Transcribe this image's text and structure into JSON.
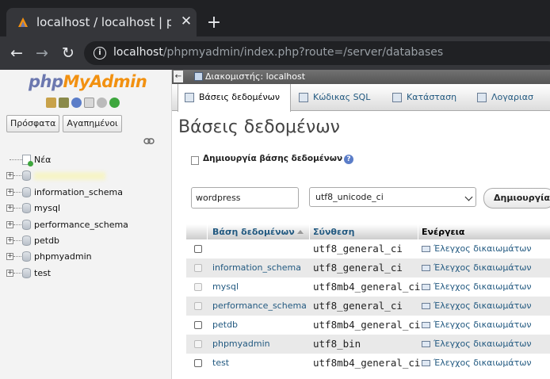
{
  "browser": {
    "tab_title": "localhost / localhost | phpMyAdmin",
    "close_glyph": "✕",
    "newtab_glyph": "+",
    "url_host": "localhost",
    "url_path": "/phpmyadmin/index.php?route=/server/databases",
    "back_glyph": "←",
    "forward_glyph": "→",
    "reload_glyph": "↻",
    "info_glyph": "i"
  },
  "leftpanel": {
    "logo_php": "php",
    "logo_myadmin": "MyAdmin",
    "tabs": [
      "Πρόσφατα",
      "Αγαπημένοι"
    ],
    "new_label": "Νέα",
    "databases": [
      "",
      "information_schema",
      "mysql",
      "performance_schema",
      "petdb",
      "phpmyadmin",
      "test"
    ],
    "expander_glyph": "+"
  },
  "content": {
    "collapse_glyph": "←",
    "server_label": "Διακομιστής: localhost",
    "menu": [
      "Βάσεις δεδομένων",
      "Κώδικας SQL",
      "Κατάσταση",
      "Λογαριασ"
    ],
    "page_title": "Βάσεις δεδομένων",
    "create_label": "Δημιουργία βάσης δεδομένων",
    "help_glyph": "?",
    "dbname_value": "wordpress",
    "collation_value": "utf8_unicode_ci",
    "create_button": "Δημιουργία",
    "table_headers": {
      "database": "Βάση δεδομένων",
      "collation": "Σύνθεση",
      "action": "Ενέργεια"
    },
    "rows": [
      {
        "name": "",
        "collation": "utf8_general_ci",
        "action": "Έλεγχος δικαιωμάτων",
        "checkbox_enabled": true
      },
      {
        "name": "information_schema",
        "collation": "utf8_general_ci",
        "action": "Έλεγχος δικαιωμάτων",
        "checkbox_enabled": false
      },
      {
        "name": "mysql",
        "collation": "utf8mb4_general_ci",
        "action": "Έλεγχος δικαιωμάτων",
        "checkbox_enabled": false
      },
      {
        "name": "performance_schema",
        "collation": "utf8_general_ci",
        "action": "Έλεγχος δικαιωμάτων",
        "checkbox_enabled": false
      },
      {
        "name": "petdb",
        "collation": "utf8mb4_general_ci",
        "action": "Έλεγχος δικαιωμάτων",
        "checkbox_enabled": true
      },
      {
        "name": "phpmyadmin",
        "collation": "utf8_bin",
        "action": "Έλεγχος δικαιωμάτων",
        "checkbox_enabled": false
      },
      {
        "name": "test",
        "collation": "utf8mb4_general_ci",
        "action": "Έλεγχος δικαιωμάτων",
        "checkbox_enabled": true
      }
    ]
  },
  "colors": {
    "chrome_dark": "#202124",
    "chrome_tab": "#35363a",
    "pma_link": "#235a81",
    "logo_php": "#6c78af",
    "logo_myadmin": "#f29111"
  }
}
